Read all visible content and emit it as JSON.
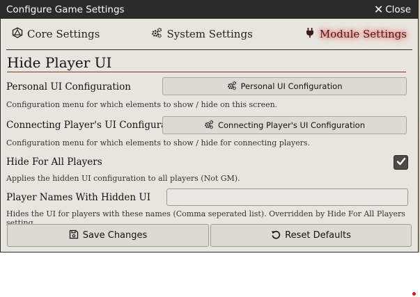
{
  "window": {
    "title": "Configure Game Settings",
    "close_label": "Close"
  },
  "tabs": [
    {
      "label": "Core Settings",
      "icon": "dice-d20-icon",
      "active": false
    },
    {
      "label": "System Settings",
      "icon": "cogs-icon",
      "active": false
    },
    {
      "label": "Module Settings",
      "icon": "plug-icon",
      "active": true
    }
  ],
  "section": {
    "title": "Hide Player UI"
  },
  "settings": {
    "personal": {
      "label": "Personal UI Configuration",
      "button_label": "Personal UI Configuration",
      "hint": "Configuration menu for which elements to show / hide on this screen."
    },
    "connecting": {
      "label": "Connecting Player's UI Configuration",
      "button_label": "Connecting Player's UI Configuration",
      "hint": "Configuration menu for which elements to show / hide for connecting players."
    },
    "hide_all": {
      "label": "Hide For All Players",
      "checked": true,
      "hint": "Applies the hidden UI configuration to all players (Not GM)."
    },
    "names": {
      "label": "Player Names With Hidden UI",
      "value": "",
      "hint": "Hides the UI for players with these names (Comma seperated list). Overridden by Hide For All Players setting."
    }
  },
  "footer": {
    "save_label": "Save Changes",
    "reset_label": "Reset Defaults"
  },
  "colors": {
    "titlebar": "#2b2b2b",
    "active_tab_glow": "#ff4444",
    "section_rule": "#8a2b2b"
  }
}
